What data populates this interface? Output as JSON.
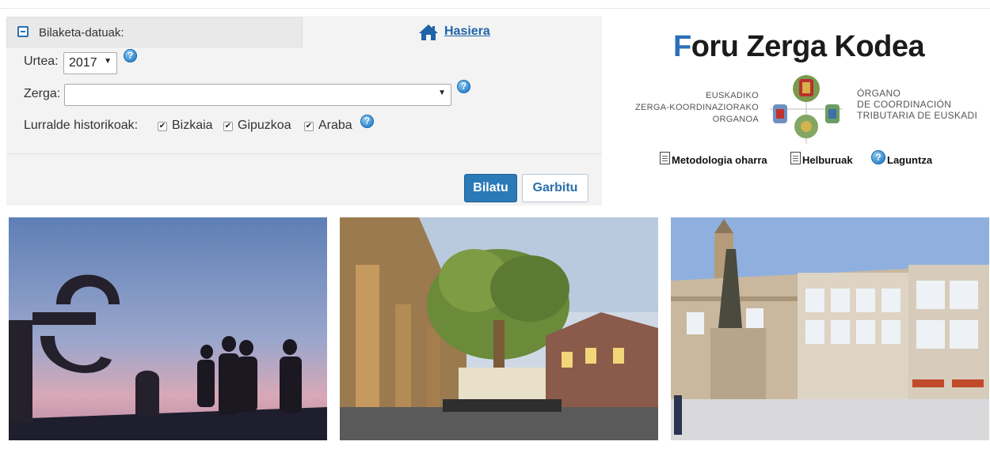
{
  "search": {
    "panel_title": "Bilaketa-datuak:",
    "year_label": "Urtea:",
    "year_value": "2017",
    "tax_label": "Zerga:",
    "tax_value": "",
    "territories_label": "Lurralde historikoak:",
    "territories": [
      {
        "label": "Bizkaia",
        "checked": true
      },
      {
        "label": "Gipuzkoa",
        "checked": true
      },
      {
        "label": "Araba",
        "checked": true
      }
    ],
    "search_button": "Bilatu",
    "clear_button": "Garbitu"
  },
  "nav": {
    "home_label": "Hasiera"
  },
  "logo": {
    "title_first": "F",
    "title_rest": "oru Zerga Kodea",
    "org_eu": [
      "EUSKADIKO",
      "ZERGA-KOORDINAZIORAKO",
      "ORGANOA"
    ],
    "org_es": [
      "ÓRGANO",
      "DE COORDINACIÓN",
      "TRIBUTARIA DE EUSKADI"
    ]
  },
  "links": {
    "methodology": "Metodologia oharra",
    "goals": "Helburuak",
    "help": "Laguntza"
  },
  "colors": {
    "accent": "#2a7ab8",
    "link": "#1f64a8",
    "panel_bg": "#f3f3f3"
  },
  "images": [
    {
      "subject": "comb-of-the-wind-sculpture-silhouettes"
    },
    {
      "subject": "gernika-tree-and-assembly-house"
    },
    {
      "subject": "vitoria-virgen-blanca-square"
    }
  ]
}
